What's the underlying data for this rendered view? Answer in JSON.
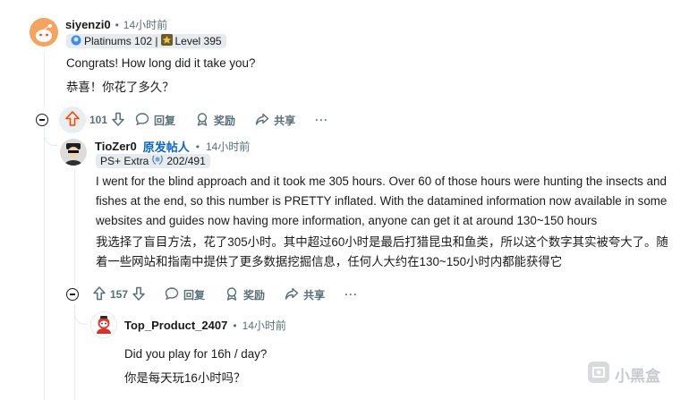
{
  "comments": [
    {
      "username": "siyenzi0",
      "time": "14小时前",
      "flair_text": "Platinums 102 |",
      "flair_level": "Level 395",
      "body_en": "Congrats! How long did it take you?",
      "body_zh": "恭喜！你花了多久？",
      "votes": "101",
      "reply_label": "回复",
      "award_label": "奖励",
      "share_label": "共享",
      "more_label": "···"
    },
    {
      "username": "TioZer0",
      "op_badge": "原发帖人",
      "time": "14小时前",
      "flair_text": "PS+ Extra",
      "flair_count": "202/491",
      "body_en": "I went for the blind approach and it took me 305 hours. Over 60 of those hours were hunting the insects and fishes at the end, so this number is PRETTY inflated. With the datamined information now available in some websites and guides now having more information, anyone can get it at around 130~150 hours",
      "body_zh": "我选择了盲目方法，花了305小时。其中超过60小时是最后打猎昆虫和鱼类，所以这个数字其实被夸大了。随着一些网站和指南中提供了更多数据挖掘信息，任何人大约在130~150小时内都能获得它",
      "votes": "157",
      "reply_label": "回复",
      "award_label": "奖励",
      "share_label": "共享",
      "more_label": "···"
    },
    {
      "username": "Top_Product_2407",
      "time": "14小时前",
      "body_en": "Did you play for 16h / day?",
      "body_zh": "你是每天玩16小时吗？"
    }
  ],
  "meta_separator": "•",
  "watermark": "小黑盒",
  "colors": {
    "accent_upvote": "#ff4500",
    "op_blue": "#0a66c2",
    "muted": "#576f76"
  }
}
